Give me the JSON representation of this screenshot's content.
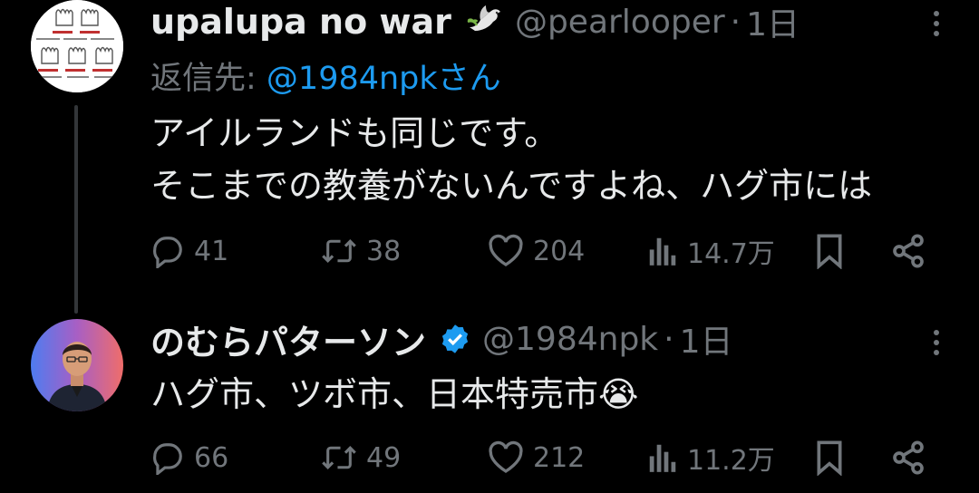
{
  "tweets": [
    {
      "author": {
        "name": "upalupa no war",
        "emoji": "🕊",
        "handle": "@pearlooper",
        "avatar": "hand-illustration-avatar"
      },
      "time": "1日",
      "separator": "·",
      "reply_to": {
        "prefix": "返信先: ",
        "mention": "@1984npkさん"
      },
      "text": [
        "アイルランドも同じです。",
        "そこまでの教養がないんですよね、ハグ市には"
      ],
      "stats": {
        "replies": "41",
        "retweets": "38",
        "likes": "204",
        "views": "14.7万"
      }
    },
    {
      "author": {
        "name": "のむらパターソン",
        "verified": true,
        "handle": "@1984npk",
        "avatar": "man-in-suit-avatar"
      },
      "time": "1日",
      "separator": "·",
      "text": [
        "ハグ市、ツボ市、日本特売市😭"
      ],
      "stats": {
        "replies": "66",
        "retweets": "49",
        "likes": "212",
        "views": "11.2万"
      }
    }
  ],
  "colors": {
    "background": "#000000",
    "text": "#e7e9ea",
    "muted": "#71767b",
    "link": "#1d9bf0",
    "verified": "#1d9bf0",
    "thread_line": "#333639"
  },
  "icons": [
    "reply-icon",
    "retweet-icon",
    "like-icon",
    "views-icon",
    "bookmark-icon",
    "share-icon",
    "more-icon",
    "verified-badge-icon"
  ]
}
